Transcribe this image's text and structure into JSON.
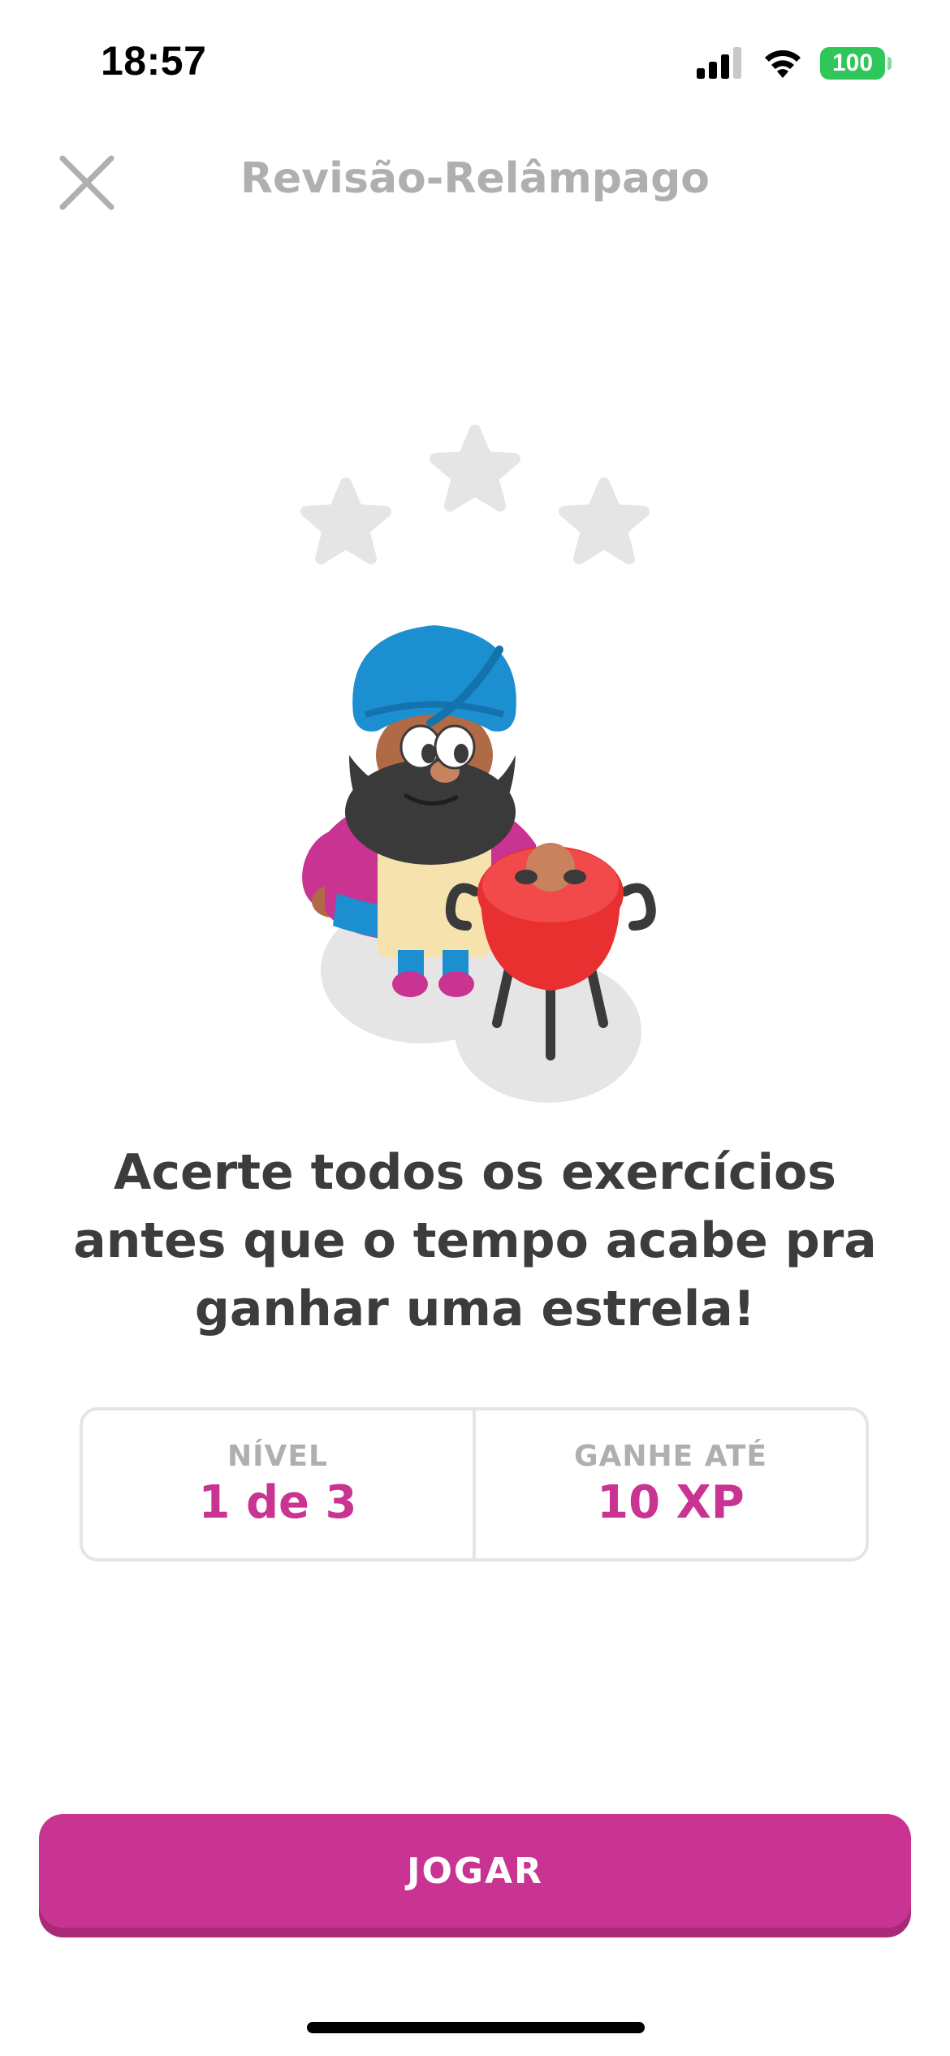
{
  "status_bar": {
    "time": "18:57",
    "battery": "100",
    "icons": [
      "signal-icon",
      "wifi-icon",
      "battery-icon"
    ]
  },
  "header": {
    "title": "Revisão-Relâmpago",
    "close_icon": "close-icon"
  },
  "illustration": {
    "stars": 3,
    "stars_earned": 0,
    "icons": [
      "star-icon",
      "character-illustration",
      "grill-illustration"
    ]
  },
  "instruction": {
    "text": "Acerte todos os exercícios antes que o tempo acabe pra ganhar uma estrela!"
  },
  "info": {
    "level_label": "NÍVEL",
    "level_value": "1 de 3",
    "reward_label": "GANHE ATÉ",
    "reward_value": "10 XP"
  },
  "actions": {
    "play_label": "JOGAR"
  },
  "colors": {
    "accent": "#c93391",
    "accent_shadow": "#a82a78",
    "text_dark": "#3c3c3c",
    "text_muted": "#afafaf",
    "border": "#e5e5e5",
    "battery": "#2fc75a"
  }
}
